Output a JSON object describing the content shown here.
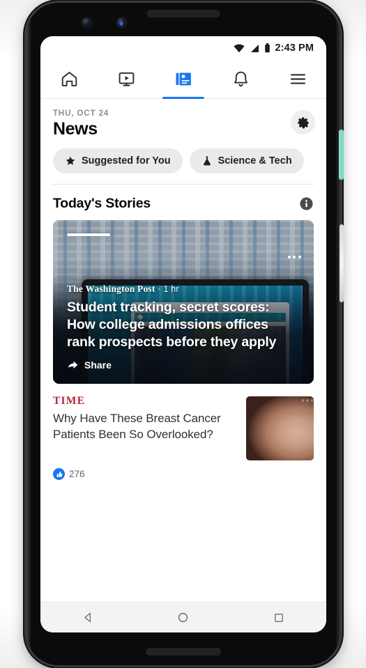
{
  "device": {
    "status_bar": {
      "time": "2:43 PM",
      "icons": [
        "wifi-icon",
        "cellular-signal-icon",
        "battery-icon"
      ]
    },
    "hardware": {
      "power_button_color": "#7DDCC5",
      "volume_button_color": "#E0E0E0"
    },
    "nav_bar": {
      "back_label": "Back",
      "home_label": "Home",
      "recents_label": "Recents"
    }
  },
  "app": {
    "tabs": [
      {
        "name": "home",
        "icon": "home-icon",
        "active": false
      },
      {
        "name": "watch",
        "icon": "video-play-icon",
        "active": false
      },
      {
        "name": "news",
        "icon": "news-feed-icon",
        "active": true
      },
      {
        "name": "notifications",
        "icon": "bell-icon",
        "active": false
      },
      {
        "name": "menu",
        "icon": "hamburger-menu-icon",
        "active": false
      }
    ],
    "accent_color": "#1877F2"
  },
  "news_header": {
    "date": "THU, OCT 24",
    "title": "News",
    "settings_icon": "gear-icon"
  },
  "chips": [
    {
      "label": "Suggested for You",
      "icon": "star-icon"
    },
    {
      "label": "Science & Tech",
      "icon": "flask-icon"
    }
  ],
  "stories_section": {
    "title": "Today's Stories",
    "info_icon": "info-icon"
  },
  "hero_story": {
    "source": "The Washington Post",
    "separator": "·",
    "age": "1 hr",
    "headline": "Student tracking, secret scores: How college admissions offices rank prospects before they apply",
    "share_label": "Share",
    "share_icon": "share-arrow-icon",
    "more_icon": "ellipsis-icon"
  },
  "list_story": {
    "source": "TIME",
    "source_color": "#B8243A",
    "headline": "Why Have These Breast Cancer Patients Been So Overlooked?",
    "reaction_count": "276",
    "reaction_icon": "thumbs-up-icon",
    "more_icon": "ellipsis-icon",
    "thumbnail_alt": "portrait-thumbnail"
  }
}
